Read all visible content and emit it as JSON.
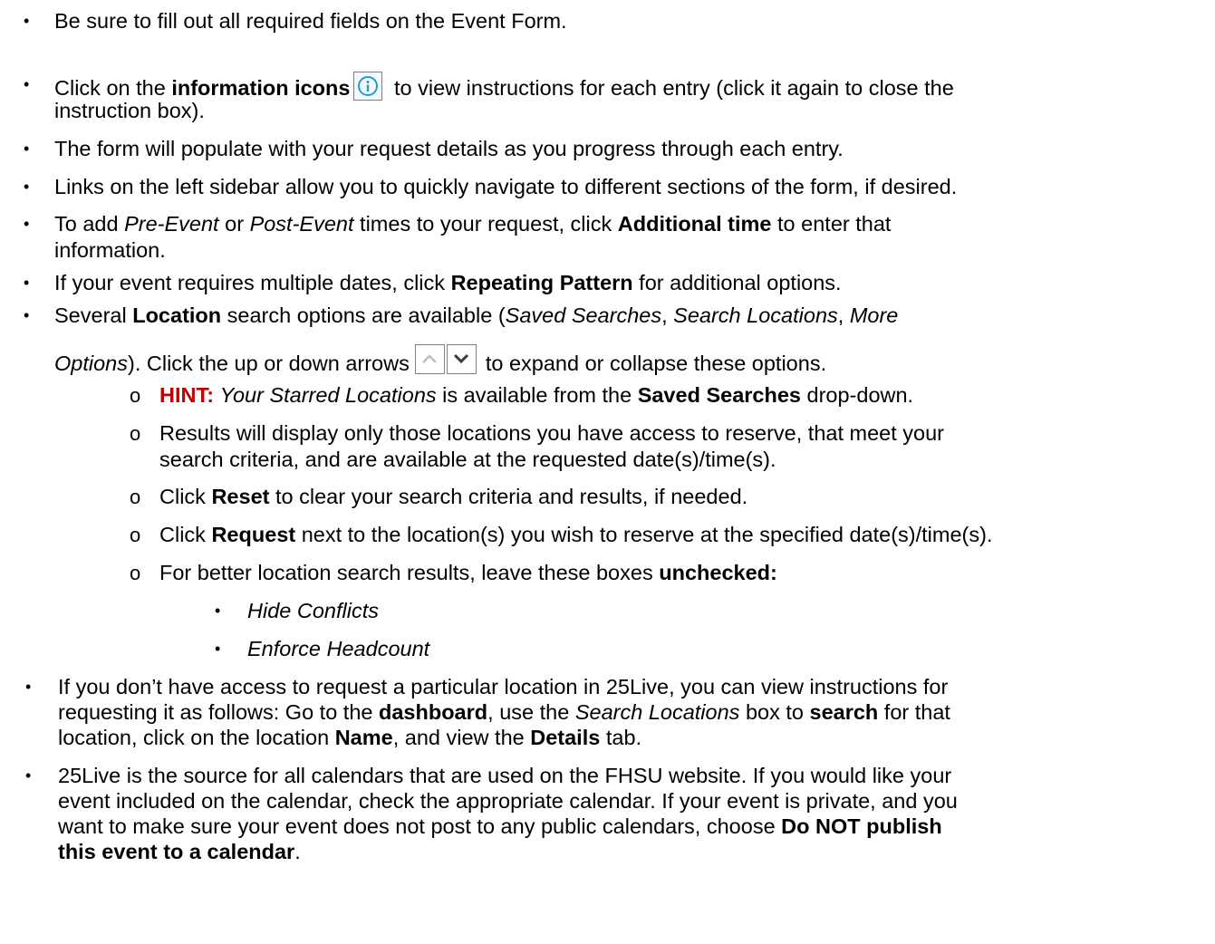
{
  "bullets": {
    "b1": {
      "text": "Be sure to fill out all required fields on the Event Form."
    },
    "b2": {
      "pre": "Click on the ",
      "bold": "information icons",
      "post": " to view instructions for each entry (click it again to close the",
      "line2": "instruction box)."
    },
    "b3": {
      "text": "The form will populate with your request details as you progress through each entry."
    },
    "b4": {
      "text": "Links on the left sidebar allow you to quickly navigate to different sections of the form, if desired."
    },
    "b5": {
      "pre": "To add ",
      "it1": "Pre-Event",
      "mid1": " or ",
      "it2": "Post-Event",
      "mid2": " times to your request, click ",
      "bold": "Additional time",
      "post": " to enter that",
      "line2": "information."
    },
    "b6": {
      "pre": "If your event requires multiple dates, click ",
      "bold": "Repeating Pattern",
      "post": " for additional options."
    },
    "b7": {
      "pre": "Several ",
      "bold": "Location",
      "mid1": " search options are available (",
      "it1": "Saved Searches",
      "sep1": ", ",
      "it2": "Search Locations",
      "sep2": ", ",
      "it3": "More",
      "it4": "Options",
      "mid2": ").  Click the up or down arrows",
      "post": "to expand or collapse these options."
    },
    "sub1": {
      "hint": "HINT:",
      "it": "Your Starred Locations",
      "mid": " is available from the ",
      "bold": "Saved Searches",
      "post": " drop-down."
    },
    "sub2": {
      "line1": "Results will display only those locations you have access to reserve, that meet your",
      "line2": "search criteria, and are available at the requested date(s)/time(s)."
    },
    "sub3": {
      "pre": "Click ",
      "bold": "Reset",
      "post": " to clear your search criteria and results, if needed."
    },
    "sub4": {
      "pre": "Click ",
      "bold": "Request",
      "post": " next to the location(s) you wish to reserve at the specified date(s)/time(s)."
    },
    "sub5": {
      "pre": "For better location search results, leave these boxes ",
      "bold": "unchecked:"
    },
    "subsub1": {
      "it": "Hide Conflicts"
    },
    "subsub2": {
      "it": "Enforce Headcount"
    },
    "b8": {
      "line1": "If you don’t have access to request a particular location in 25Live, you can view instructions for",
      "pre2": "requesting it as follows:  Go to the ",
      "bold1": "dashboard",
      "mid1": ", use the ",
      "it1": "Search Locations",
      "mid2": " box to ",
      "bold2": "search",
      "post2": " for that",
      "pre3": "location, click on the location ",
      "bold3": "Name",
      "mid3": ", and view the ",
      "bold4": "Details",
      "post3": " tab."
    },
    "b9": {
      "line1": "25Live is the source for all calendars that are used on the FHSU website.  If you would like your",
      "line2": "event included on the calendar, check the appropriate calendar.  If your event is private, and you",
      "pre3": "want to make sure your event does not post to any public calendars, choose ",
      "bold3": "Do NOT publish",
      "bold4": "this event to a calendar",
      "post4": "."
    }
  },
  "icons": {
    "info": "information-icon",
    "up": "chevron-up-icon",
    "down": "chevron-down-icon",
    "accent": "#1f9bd6"
  }
}
